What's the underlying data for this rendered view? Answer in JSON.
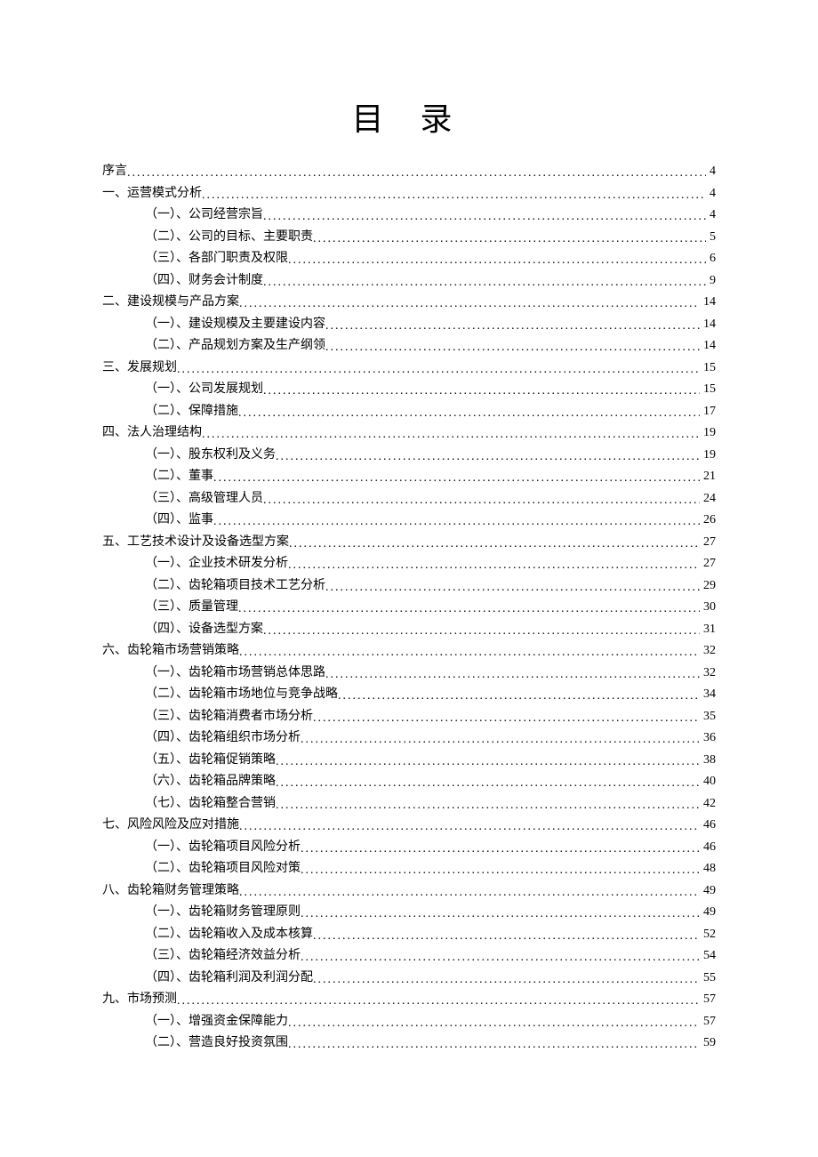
{
  "title": "目 录",
  "toc": [
    {
      "level": 0,
      "label": "序言",
      "page": "4"
    },
    {
      "level": 0,
      "label": "一、运营模式分析",
      "page": "4"
    },
    {
      "level": 1,
      "label": "（一）、公司经营宗旨",
      "page": "4"
    },
    {
      "level": 1,
      "label": "（二）、公司的目标、主要职责",
      "page": "5"
    },
    {
      "level": 1,
      "label": "（三）、各部门职责及权限",
      "page": "6"
    },
    {
      "level": 1,
      "label": "（四）、财务会计制度",
      "page": "9"
    },
    {
      "level": 0,
      "label": "二、建设规模与产品方案",
      "page": "14"
    },
    {
      "level": 1,
      "label": "（一）、建设规模及主要建设内容",
      "page": "14"
    },
    {
      "level": 1,
      "label": "（二）、产品规划方案及生产纲领",
      "page": "14"
    },
    {
      "level": 0,
      "label": "三、发展规划",
      "page": "15"
    },
    {
      "level": 1,
      "label": "（一）、公司发展规划",
      "page": "15"
    },
    {
      "level": 1,
      "label": "（二）、保障措施",
      "page": "17"
    },
    {
      "level": 0,
      "label": "四、法人治理结构",
      "page": "19"
    },
    {
      "level": 1,
      "label": "（一）、股东权利及义务",
      "page": "19"
    },
    {
      "level": 1,
      "label": "（二）、董事",
      "page": "21"
    },
    {
      "level": 1,
      "label": "（三）、高级管理人员",
      "page": "24"
    },
    {
      "level": 1,
      "label": "（四）、监事",
      "page": "26"
    },
    {
      "level": 0,
      "label": "五、工艺技术设计及设备选型方案",
      "page": "27"
    },
    {
      "level": 1,
      "label": "（一）、企业技术研发分析",
      "page": "27"
    },
    {
      "level": 1,
      "label": "（二）、齿轮箱项目技术工艺分析",
      "page": "29"
    },
    {
      "level": 1,
      "label": "（三）、质量管理",
      "page": "30"
    },
    {
      "level": 1,
      "label": "（四）、设备选型方案",
      "page": "31"
    },
    {
      "level": 0,
      "label": "六、齿轮箱市场营销策略",
      "page": "32"
    },
    {
      "level": 1,
      "label": "（一）、齿轮箱市场营销总体思路",
      "page": "32"
    },
    {
      "level": 1,
      "label": "（二）、齿轮箱市场地位与竞争战略",
      "page": "34"
    },
    {
      "level": 1,
      "label": "（三）、齿轮箱消费者市场分析",
      "page": "35"
    },
    {
      "level": 1,
      "label": "（四）、齿轮箱组织市场分析",
      "page": "36"
    },
    {
      "level": 1,
      "label": "（五）、齿轮箱促销策略",
      "page": "38"
    },
    {
      "level": 1,
      "label": "（六）、齿轮箱品牌策略",
      "page": "40"
    },
    {
      "level": 1,
      "label": "（七）、齿轮箱整合营销",
      "page": "42"
    },
    {
      "level": 0,
      "label": "七、风险风险及应对措施",
      "page": "46"
    },
    {
      "level": 1,
      "label": "（一）、齿轮箱项目风险分析",
      "page": "46"
    },
    {
      "level": 1,
      "label": "（二）、齿轮箱项目风险对策",
      "page": "48"
    },
    {
      "level": 0,
      "label": "八、齿轮箱财务管理策略",
      "page": "49"
    },
    {
      "level": 1,
      "label": "（一）、齿轮箱财务管理原则",
      "page": "49"
    },
    {
      "level": 1,
      "label": "（二）、齿轮箱收入及成本核算",
      "page": "52"
    },
    {
      "level": 1,
      "label": "（三）、齿轮箱经济效益分析",
      "page": "54"
    },
    {
      "level": 1,
      "label": "（四）、齿轮箱利润及利润分配",
      "page": "55"
    },
    {
      "level": 0,
      "label": "九、市场预测",
      "page": "57"
    },
    {
      "level": 1,
      "label": "（一）、增强资金保障能力",
      "page": "57"
    },
    {
      "level": 1,
      "label": "（二）、营造良好投资氛围",
      "page": "59"
    }
  ]
}
